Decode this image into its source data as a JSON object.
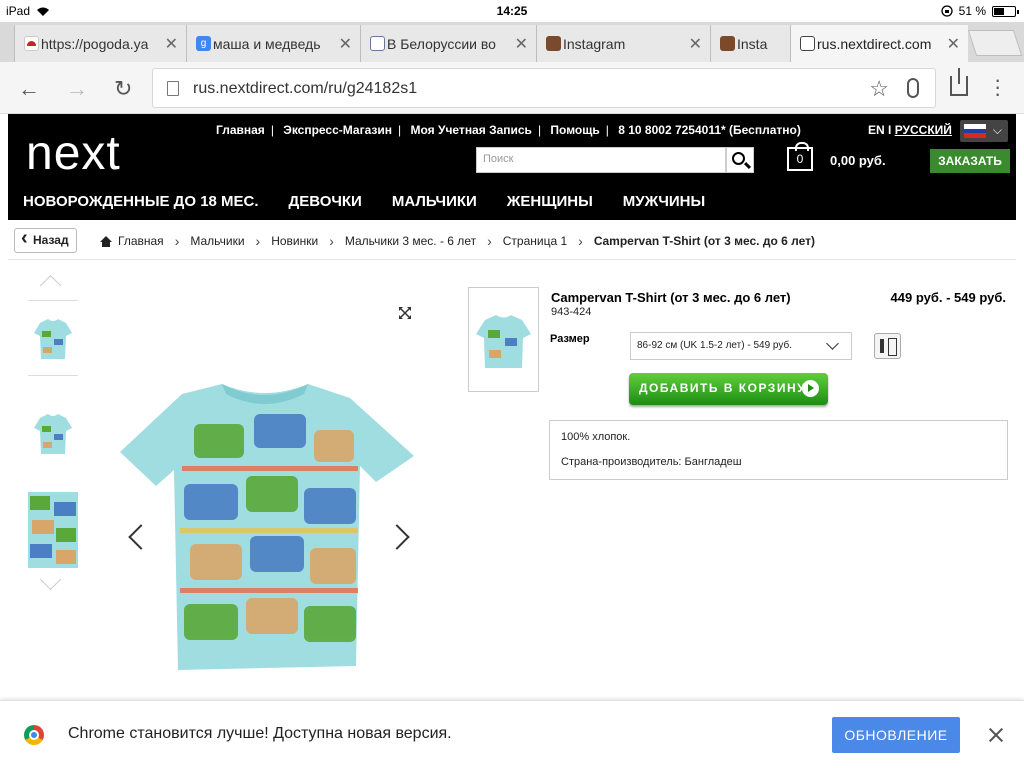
{
  "status_bar": {
    "device": "iPad",
    "time": "14:25",
    "battery": "51 %",
    "battery_level": 0.51
  },
  "tabs": [
    {
      "title": "https://pogoda.ya",
      "icon": "yandex-weather-icon",
      "color": "#cc2222"
    },
    {
      "title": "маша и медведь",
      "icon": "google-search-icon",
      "color": "#4285f4"
    },
    {
      "title": "В Белоруссии во",
      "icon": "document-icon",
      "color": "#667799"
    },
    {
      "title": "Instagram",
      "icon": "instagram-icon",
      "color": "#7a4a2a"
    },
    {
      "title": "Insta",
      "icon": "instagram-icon",
      "color": "#7a4a2a"
    },
    {
      "title": "rus.nextdirect.com",
      "icon": "next-icon",
      "color": "#444444"
    }
  ],
  "address_bar": {
    "url": "rus.nextdirect.com/ru/g24182s1"
  },
  "site": {
    "logo": "next",
    "top_links": [
      "Главная",
      "Экспресс-Магазин",
      "Моя Учетная Запись",
      "Помощь",
      "8 10 8002 7254011* (Бесплатно)"
    ],
    "lang_en": "EN I",
    "lang_ru": "РУССКИЙ",
    "search_placeholder": "Поиск",
    "bag_count": "0",
    "bag_total": "0,00 руб.",
    "order_button": "ЗАКАЗАТЬ",
    "nav": [
      "НОВОРОЖДЕННЫЕ ДО 18 МЕС.",
      "ДЕВОЧКИ",
      "МАЛЬЧИКИ",
      "ЖЕНЩИНЫ",
      "МУЖЧИНЫ"
    ],
    "back_button": "Назад",
    "breadcrumbs": [
      "Главная",
      "Мальчики",
      "Новинки",
      "Мальчики 3 мес. - 6 лет",
      "Страница 1",
      "Campervan T-Shirt (от 3 мес. до 6 лет)"
    ]
  },
  "product": {
    "title": "Campervan T-Shirt (от 3 мес. до 6 лет)",
    "price": "449 руб. - 549 руб.",
    "code": "943-424",
    "size_label": "Размер",
    "size_selected": "86-92 см (UK 1.5-2 лет) - 549 руб.",
    "add_to_cart": "ДОБАВИТЬ В КОРЗИНУ",
    "description": [
      "100% хлопок.",
      "Страна-производитель: Бангладеш"
    ],
    "shirt_color": "#9fdde0"
  },
  "chrome_update": {
    "message": "Chrome становится лучше! Доступна новая версия.",
    "button": "ОБНОВЛЕНИЕ"
  }
}
